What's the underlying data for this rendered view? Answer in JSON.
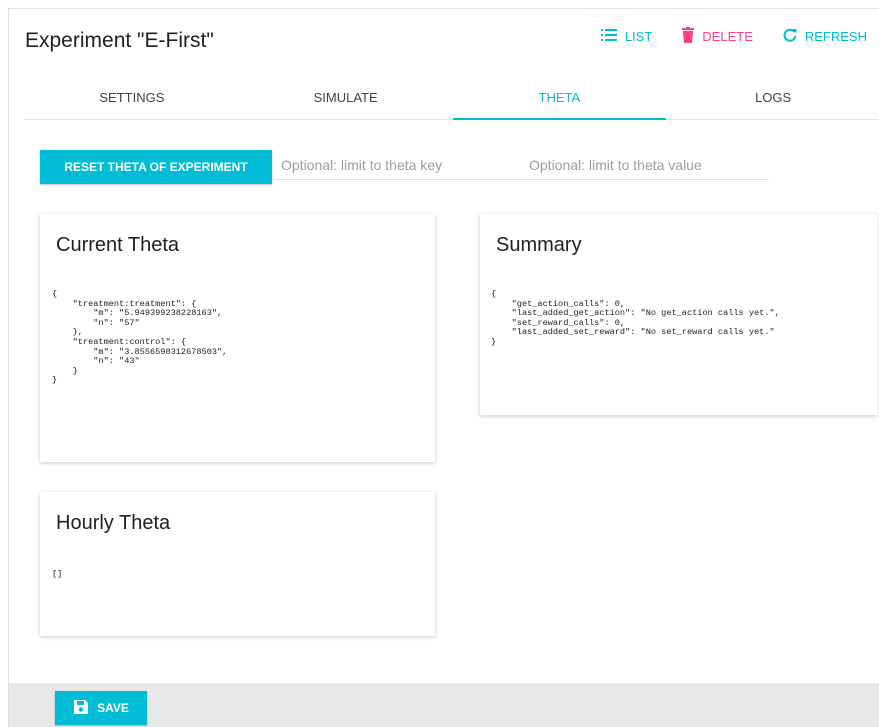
{
  "header": {
    "title": "Experiment \"E-First\"",
    "actions": {
      "list": "LIST",
      "delete": "DELETE",
      "refresh": "REFRESH"
    }
  },
  "tabs": [
    {
      "label": "SETTINGS"
    },
    {
      "label": "SIMULATE"
    },
    {
      "label": "THETA",
      "active": true
    },
    {
      "label": "LOGS"
    }
  ],
  "controls": {
    "reset_label": "RESET THETA OF EXPERIMENT",
    "key_placeholder": "Optional: limit to theta key",
    "value_placeholder": "Optional: limit to theta value"
  },
  "current_theta": {
    "title": "Current Theta",
    "json": "{\n    \"treatment:treatment\": {\n        \"m\": \"5.949399238228163\",\n        \"n\": \"57\"\n    },\n    \"treatment:control\": {\n        \"m\": \"3.8556598312678503\",\n        \"n\": \"43\"\n    }\n}"
  },
  "summary": {
    "title": "Summary",
    "json": "{\n    \"get_action_calls\": 0,\n    \"last_added_get_action\": \"No get_action calls yet.\",\n    \"set_reward_calls\": 0,\n    \"last_added_set_reward\": \"No set_reward calls yet.\"\n}"
  },
  "hourly_theta": {
    "title": "Hourly Theta",
    "json": "[]"
  },
  "footer": {
    "save_label": "SAVE"
  },
  "colors": {
    "accent": "#00bcd4",
    "danger": "#ff4081"
  }
}
